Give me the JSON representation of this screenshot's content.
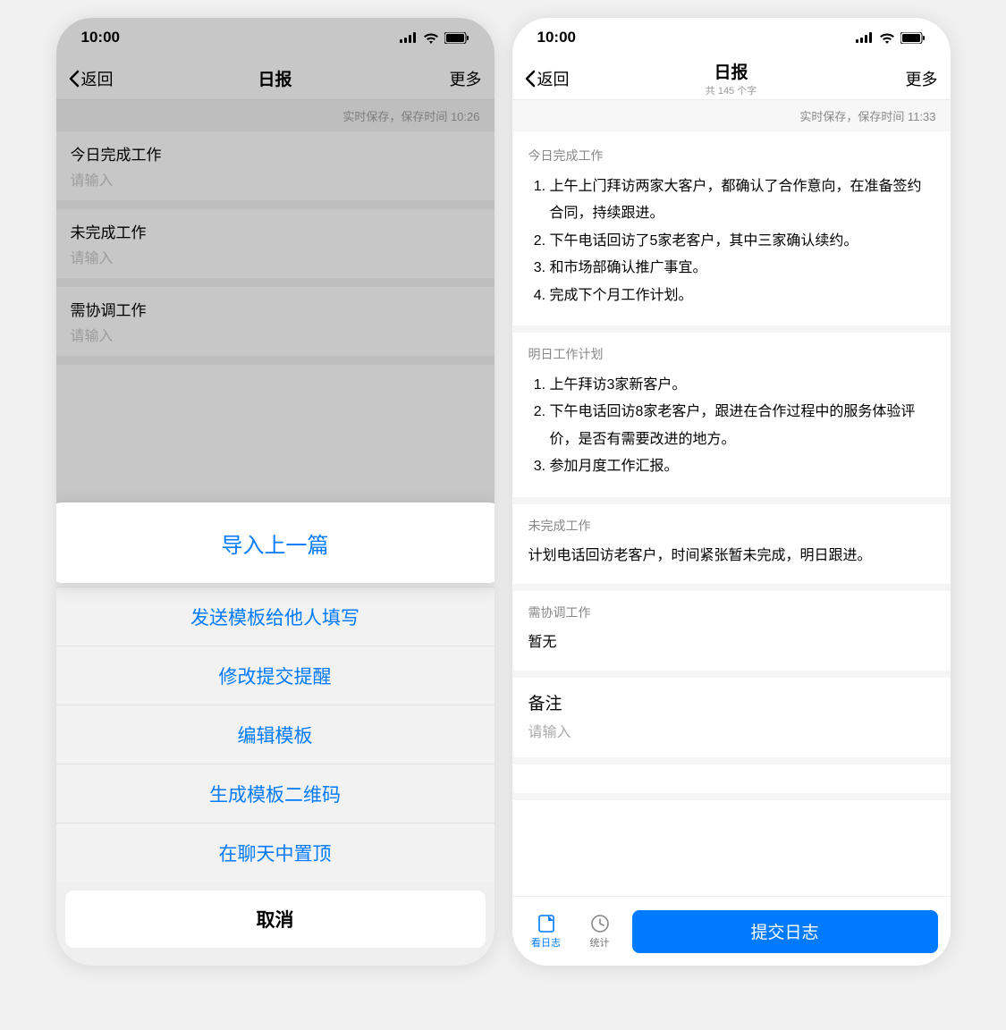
{
  "left": {
    "status_time": "10:00",
    "nav": {
      "back": "返回",
      "title": "日报",
      "more": "更多"
    },
    "save_hint": "实时保存，保存时间 10:26",
    "sections": [
      {
        "title": "今日完成工作",
        "placeholder": "请输入"
      },
      {
        "title": "未完成工作",
        "placeholder": "请输入"
      },
      {
        "title": "需协调工作",
        "placeholder": "请输入"
      }
    ],
    "sheet": {
      "highlight": "导入上一篇",
      "items": [
        "发送模板给他人填写",
        "修改提交提醒",
        "编辑模板",
        "生成模板二维码",
        "在聊天中置顶"
      ],
      "cancel": "取消"
    }
  },
  "right": {
    "status_time": "10:00",
    "nav": {
      "back": "返回",
      "title": "日报",
      "subtitle": "共 145 个字",
      "more": "更多"
    },
    "save_hint": "实时保存，保存时间 11:33",
    "today": {
      "title": "今日完成工作",
      "items": [
        "上午上门拜访两家大客户，都确认了合作意向，在准备签约合同，持续跟进。",
        "下午电话回访了5家老客户，其中三家确认续约。",
        "和市场部确认推广事宜。",
        "完成下个月工作计划。"
      ]
    },
    "tomorrow": {
      "title": "明日工作计划",
      "items": [
        "上午拜访3家新客户。",
        "下午电话回访8家老客户，跟进在合作过程中的服务体验评价，是否有需要改进的地方。",
        "参加月度工作汇报。"
      ]
    },
    "incomplete": {
      "title": "未完成工作",
      "text": "计划电话回访老客户，时间紧张暂未完成，明日跟进。"
    },
    "coord": {
      "title": "需协调工作",
      "text": "暂无"
    },
    "remark": {
      "title": "备注",
      "placeholder": "请输入"
    },
    "bottom": {
      "view": "看日志",
      "stats": "统计",
      "submit": "提交日志"
    }
  }
}
